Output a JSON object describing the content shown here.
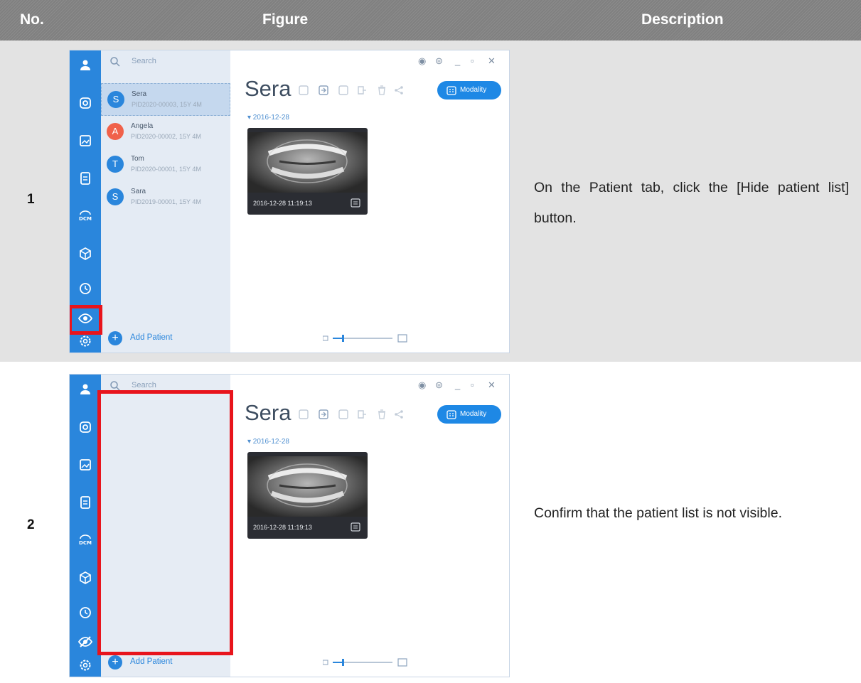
{
  "header": {
    "no": "No.",
    "figure": "Figure",
    "description": "Description"
  },
  "colors": {
    "rail": "#2a86dc",
    "highlight": "#e8141c",
    "header": "#808080"
  },
  "rows": [
    {
      "no": "1",
      "description": "On the Patient tab, click the [Hide patient list] button.",
      "app": {
        "search_placeholder": "Search",
        "patient_name": "Sera",
        "modality_label": "Modality",
        "date_group": "▾ 2016-12-28",
        "thumb_caption": "2016-12-28  11:19:13",
        "add_patient": "Add Patient",
        "patients": [
          {
            "initial": "S",
            "name": "Sera",
            "id": "PID2020-00003, 15Y 4M",
            "color": "#2a86dc"
          },
          {
            "initial": "A",
            "name": "Angela",
            "id": "PID2020-00002, 15Y 4M",
            "color": "#f0614a"
          },
          {
            "initial": "T",
            "name": "Tom",
            "id": "PID2020-00001, 15Y 4M",
            "color": "#2a86dc"
          },
          {
            "initial": "S",
            "name": "Sara",
            "id": "PID2019-00001, 15Y 4M",
            "color": "#2a86dc"
          }
        ],
        "list_state": "visible"
      }
    },
    {
      "no": "2",
      "description": "Confirm that the patient list is not visible.",
      "app": {
        "search_placeholder": "Search",
        "patient_name": "Sera",
        "modality_label": "Modality",
        "date_group": "▾ 2016-12-28",
        "thumb_caption": "2016-12-28  11:19:13",
        "add_patient": "Add Patient",
        "list_state": "hidden"
      }
    }
  ]
}
